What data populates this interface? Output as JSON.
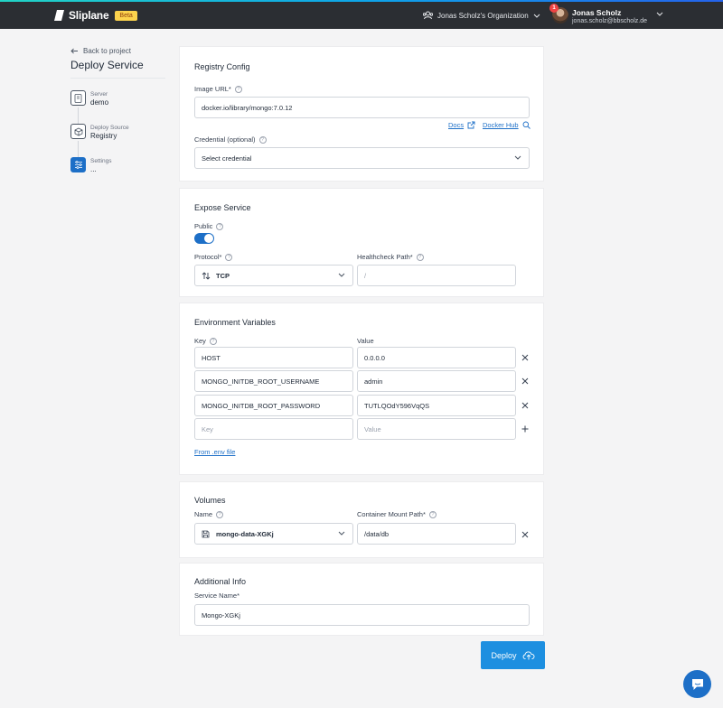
{
  "app": {
    "name": "Sliplane",
    "badge": "Beta"
  },
  "header": {
    "organization": "Jonas Scholz's Organization",
    "notifications": "1",
    "user_name": "Jonas Scholz",
    "user_email": "jonas.scholz@bbscholz.de"
  },
  "sidebar": {
    "back": "Back to project",
    "title": "Deploy Service",
    "steps": [
      {
        "label": "Server",
        "value": "demo"
      },
      {
        "label": "Deploy Source",
        "value": "Registry"
      },
      {
        "label": "Settings",
        "value": "..."
      }
    ]
  },
  "registry": {
    "title": "Registry Config",
    "image_label": "Image URL*",
    "image_value": "docker.io/library/mongo:7.0.12",
    "docs": "Docs",
    "docker_hub": "Docker Hub",
    "credential_label": "Credential (optional)",
    "credential_value": "Select credential"
  },
  "expose": {
    "title": "Expose Service",
    "public_label": "Public",
    "public_on": true,
    "protocol_label": "Protocol*",
    "protocol_value": "TCP",
    "healthcheck_label": "Healthcheck Path*",
    "healthcheck_value": "/"
  },
  "env": {
    "title": "Environment Variables",
    "key_label": "Key",
    "value_label": "Value",
    "rows": [
      {
        "key": "HOST",
        "value": "0.0.0.0"
      },
      {
        "key": "MONGO_INITDB_ROOT_USERNAME",
        "value": "admin"
      },
      {
        "key": "MONGO_INITDB_ROOT_PASSWORD",
        "value": "TUTLQOdY596VqQS"
      }
    ],
    "key_placeholder": "Key",
    "value_placeholder": "Value",
    "from_env": "From .env file"
  },
  "volumes": {
    "title": "Volumes",
    "name_label": "Name",
    "name_value": "mongo-data-XGKj",
    "mount_label": "Container Mount Path*",
    "mount_value": "/data/db"
  },
  "additional": {
    "title": "Additional Info",
    "service_label": "Service Name*",
    "service_value": "Mongo-XGKj"
  },
  "deploy_label": "Deploy"
}
